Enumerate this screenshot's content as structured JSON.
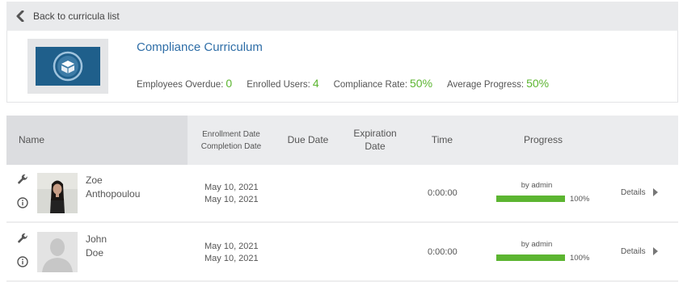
{
  "back": {
    "label": "Back to curricula list",
    "icon": "chevron-left-icon"
  },
  "curriculum": {
    "title": "Compliance Curriculum",
    "icon": "box-icon",
    "stats": [
      {
        "label": "Employees Overdue:",
        "value": "0"
      },
      {
        "label": "Enrolled Users:",
        "value": "4"
      },
      {
        "label": "Compliance Rate:",
        "value": "50%"
      },
      {
        "label": "Average Progress:",
        "value": "50%"
      }
    ]
  },
  "table": {
    "headers": {
      "name": "Name",
      "enrollment": "Enrollment Date",
      "completion": "Completion Date",
      "due": "Due Date",
      "expiration_1": "Expiration",
      "expiration_2": "Date",
      "time": "Time",
      "progress": "Progress"
    },
    "rows": [
      {
        "first": "Zoe",
        "last": "Anthopoulou",
        "enrollment": "May 10, 2021",
        "completion": "May 10, 2021",
        "due": "",
        "expiration": "",
        "time": "0:00:00",
        "by": "by admin",
        "progress": 100,
        "progress_label": "100%",
        "details": "Details"
      },
      {
        "first": "John",
        "last": "Doe",
        "enrollment": "May 10, 2021",
        "completion": "May 10, 2021",
        "due": "",
        "expiration": "",
        "time": "0:00:00",
        "by": "by admin",
        "progress": 100,
        "progress_label": "100%",
        "details": "Details"
      }
    ]
  },
  "colors": {
    "accent": "#2f6ea7",
    "success": "#5cb531",
    "thumb_bg": "#1f5f8b"
  }
}
